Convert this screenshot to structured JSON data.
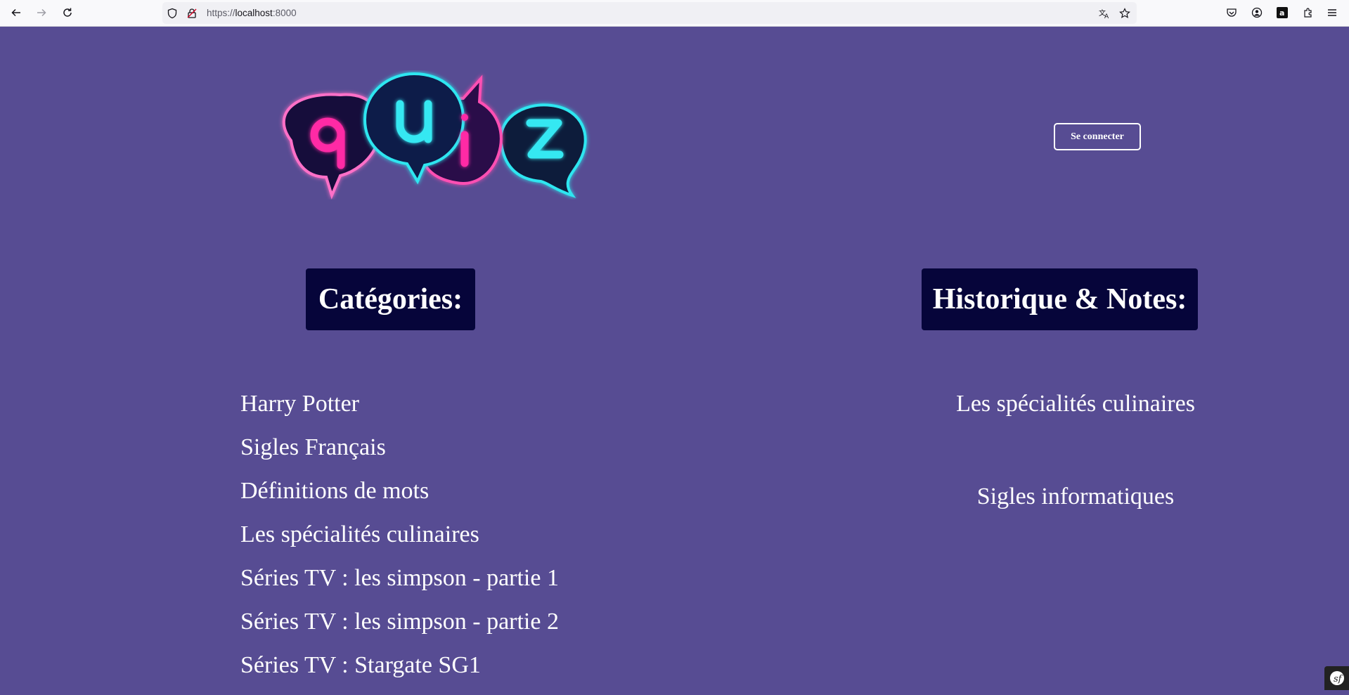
{
  "browser": {
    "url_scheme": "https://",
    "url_host": "localhost",
    "url_port": ":8000",
    "icons": [
      "back-icon",
      "forward-icon",
      "reload-icon",
      "shield-icon",
      "lock-icon",
      "translate-icon",
      "bookmark-star-icon",
      "pocket-icon",
      "account-icon",
      "amazon-icon",
      "extensions-icon",
      "menu-icon"
    ]
  },
  "header": {
    "logo_text": "quiz",
    "login_label": "Se connecter"
  },
  "categories": {
    "title": "Catégories:",
    "items": [
      "Harry Potter",
      "Sigles Français",
      "Définitions de mots",
      "Les spécialités culinaires",
      "Séries TV : les simpson - partie 1",
      "Séries TV : les simpson - partie 2",
      "Séries TV : Stargate SG1"
    ]
  },
  "history": {
    "title": "Historique & Notes:",
    "items": [
      "Les spécialités culinaires",
      "Sigles informatiques"
    ]
  },
  "colors": {
    "page_bg": "#574c93",
    "heading_bg": "#06053a",
    "neon_pink": "#ff4fb3",
    "neon_cyan": "#2fe6f0"
  }
}
